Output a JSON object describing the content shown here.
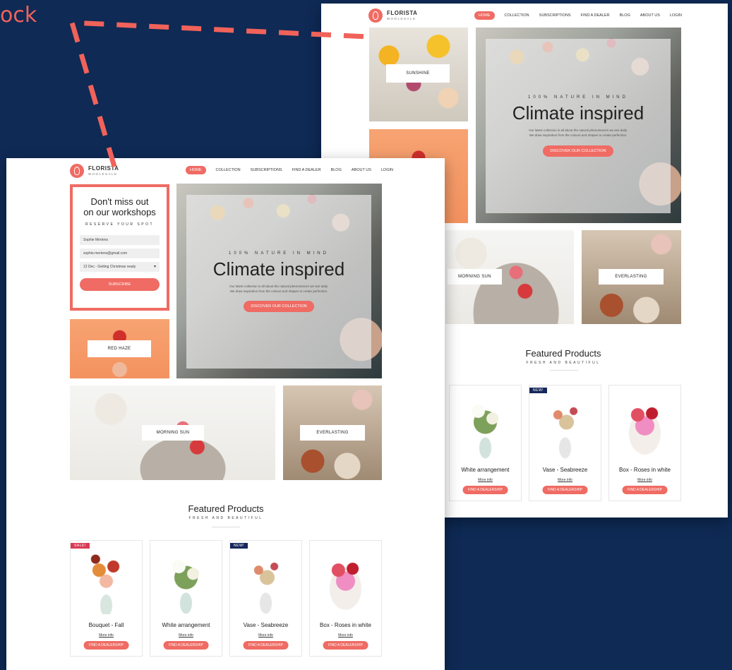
{
  "corner_text": "ock",
  "colors": {
    "background": "#0e2a55",
    "accent": "#ef6b63",
    "connector": "#f0625a"
  },
  "brand": {
    "name": "FLORISTA",
    "tagline": "WHOLESALE",
    "logo_icon": "flower-logo-icon"
  },
  "nav": [
    "HOME",
    "COLLECTION",
    "SUBSCRIPTIONS",
    "FIND A DEALER",
    "BLOG",
    "ABOUT US",
    "LOGIN"
  ],
  "nav_active": "HOME",
  "hero": {
    "eyebrow": "100% NATURE IN MIND",
    "title": "Climate inspired",
    "desc_line1": "Our latest collection is all about the natural phenomena's we see daily.",
    "desc_line2": "We draw inspiration from the colours and shapes to create perfection.",
    "cta": "DISCOVER OUR COLLECTION"
  },
  "workshop": {
    "title_line1": "Don't miss out",
    "title_line2": "on our workshops",
    "subtitle": "RESERVE YOUR SPOT",
    "name_value": "Sophie Mertens",
    "email_value": "sophie.mertens@gmail.com",
    "session_value": "12 Dec - Getting Christmas ready",
    "submit": "SUBSCRIBE"
  },
  "tiles": {
    "sunshine": "SUNSHINE",
    "red_haze": "RED HAZE",
    "morning_sun": "MORNING SUN",
    "everlasting": "EVERLASTING"
  },
  "featured": {
    "title": "Featured Products",
    "subtitle": "FRESH AND BEAUTIFUL"
  },
  "products": [
    {
      "name": "Bouquet - Fall",
      "badge": "SALE!",
      "link": "More info",
      "cta": "FIND A DEALERSHIP"
    },
    {
      "name": "White arrangement",
      "badge": "",
      "link": "More info",
      "cta": "FIND A DEALERSHIP"
    },
    {
      "name": "Vase - Seabreeze",
      "badge": "NEW!",
      "link": "More info",
      "cta": "FIND A DEALERSHIP"
    },
    {
      "name": "Box - Roses in white",
      "badge": "",
      "link": "More info",
      "cta": "FIND A DEALERSHIP"
    }
  ]
}
